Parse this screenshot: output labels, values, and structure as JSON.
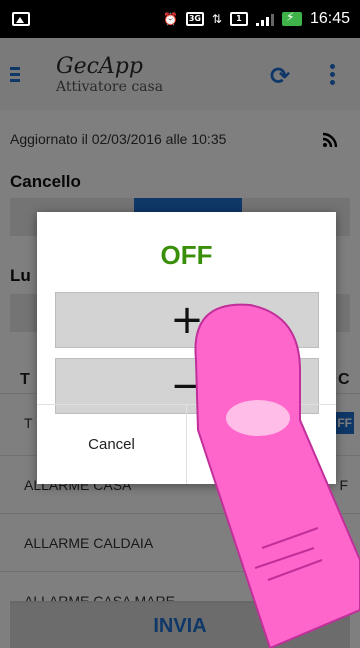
{
  "statusbar": {
    "net": "3G",
    "sim": "1",
    "time": "16:45"
  },
  "app": {
    "name": "GecApp",
    "subtitle": "Attivatore casa"
  },
  "updated_text": "Aggiornato il 02/03/2016 alle 10:35",
  "sections": {
    "cancello": "Cancello",
    "luci_partial": "Lu"
  },
  "table": {
    "head_left": "T",
    "head_right": "C"
  },
  "rows": [
    {
      "label": "T",
      "state": "FF",
      "state_style": "button"
    },
    {
      "label": "ALLARME CASA",
      "state": "F"
    },
    {
      "label": "ALLARME CALDAIA",
      "state": "F"
    },
    {
      "label": "ALLARME CASA MARE",
      "state": ""
    }
  ],
  "invia_label": "INVIA",
  "dialog": {
    "status": "OFF",
    "plus": "+",
    "minus": "−",
    "cancel": "Cancel",
    "ok": ""
  },
  "colors": {
    "accent": "#1e6fd0",
    "status_off": "#3a8f0a",
    "finger": "#ff66cc"
  }
}
